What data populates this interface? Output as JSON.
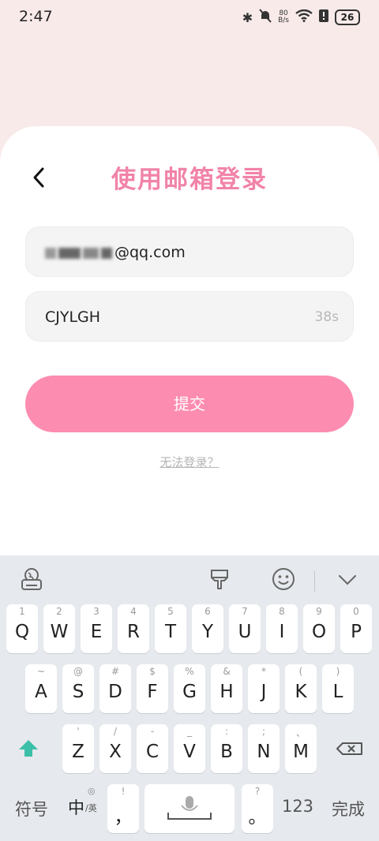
{
  "status_bar": {
    "time": "2:47",
    "net_speed_top": "80",
    "net_speed_bottom": "B/s",
    "battery": "26"
  },
  "header": {
    "title": "使用邮箱登录"
  },
  "form": {
    "email_suffix": "@qq.com",
    "code_value": "CJYLGH",
    "code_timer": "38s",
    "submit_label": "提交",
    "help_link": "无法登录？"
  },
  "keyboard": {
    "row1": [
      {
        "main": "Q",
        "sub": "1"
      },
      {
        "main": "W",
        "sub": "2"
      },
      {
        "main": "E",
        "sub": "3"
      },
      {
        "main": "R",
        "sub": "4"
      },
      {
        "main": "T",
        "sub": "5"
      },
      {
        "main": "Y",
        "sub": "6"
      },
      {
        "main": "U",
        "sub": "7"
      },
      {
        "main": "I",
        "sub": "8"
      },
      {
        "main": "O",
        "sub": "9"
      },
      {
        "main": "P",
        "sub": "0"
      }
    ],
    "row2": [
      {
        "main": "A",
        "sub": "~"
      },
      {
        "main": "S",
        "sub": "@"
      },
      {
        "main": "D",
        "sub": "#"
      },
      {
        "main": "F",
        "sub": "$"
      },
      {
        "main": "G",
        "sub": "%"
      },
      {
        "main": "H",
        "sub": "&"
      },
      {
        "main": "J",
        "sub": "*"
      },
      {
        "main": "K",
        "sub": "("
      },
      {
        "main": "L",
        "sub": ")"
      }
    ],
    "row3": [
      {
        "main": "Z",
        "sub": "'"
      },
      {
        "main": "X",
        "sub": "/"
      },
      {
        "main": "C",
        "sub": "-"
      },
      {
        "main": "V",
        "sub": "_"
      },
      {
        "main": "B",
        "sub": ":"
      },
      {
        "main": "N",
        "sub": ";"
      },
      {
        "main": "M",
        "sub": "、"
      }
    ],
    "symbols_label": "符号",
    "lang_main": "中",
    "lang_sub": "/英",
    "comma": {
      "main": "，",
      "sub": "!"
    },
    "period": {
      "main": "。",
      "sub": "?"
    },
    "numbers_label": "123",
    "done_label": "完成"
  },
  "colors": {
    "accent": "#fd8cb1",
    "title": "#f183a9",
    "shift": "#3cbfa8"
  }
}
